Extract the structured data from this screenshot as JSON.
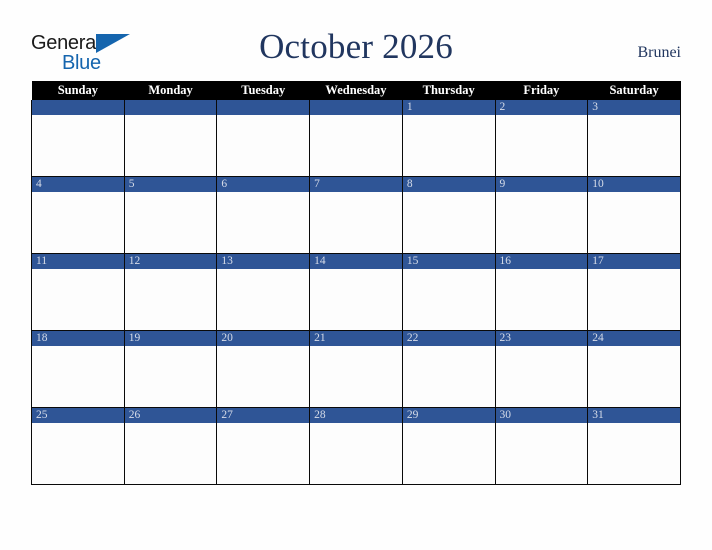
{
  "brand": {
    "name_part1": "General",
    "name_part2": "Blue",
    "triangle_icon": "triangle-icon",
    "colors": {
      "black": "#1A1A1A",
      "blue": "#1565AE"
    }
  },
  "header": {
    "title": "October 2026",
    "country": "Brunei",
    "title_color": "#21365F"
  },
  "calendar": {
    "weekday_headers": [
      "Sunday",
      "Monday",
      "Tuesday",
      "Wednesday",
      "Thursday",
      "Friday",
      "Saturday"
    ],
    "colors": {
      "header_background": "#000000",
      "header_text": "#FFFFFF",
      "daynum_band": "#2F5596",
      "daynum_text": "#D6DCE8",
      "cell_background": "#FDFDFD",
      "grid_line": "#0A0A0A"
    },
    "weeks": [
      [
        "",
        "",
        "",
        "",
        "1",
        "2",
        "3"
      ],
      [
        "4",
        "5",
        "6",
        "7",
        "8",
        "9",
        "10"
      ],
      [
        "11",
        "12",
        "13",
        "14",
        "15",
        "16",
        "17"
      ],
      [
        "18",
        "19",
        "20",
        "21",
        "22",
        "23",
        "24"
      ],
      [
        "25",
        "26",
        "27",
        "28",
        "29",
        "30",
        "31"
      ]
    ]
  }
}
